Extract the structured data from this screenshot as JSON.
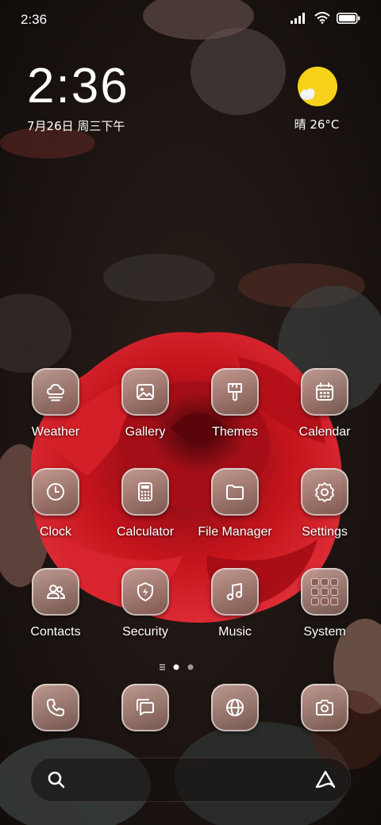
{
  "status_bar": {
    "time": "2:36"
  },
  "clock_widget": {
    "time": "2:36",
    "date": "7月26日 周三下午"
  },
  "weather_widget": {
    "text": "晴 26°C"
  },
  "apps": [
    {
      "label": "Weather",
      "icon": "cloud-icon"
    },
    {
      "label": "Gallery",
      "icon": "image-icon"
    },
    {
      "label": "Themes",
      "icon": "brush-icon"
    },
    {
      "label": "Calendar",
      "icon": "calendar-icon"
    },
    {
      "label": "Clock",
      "icon": "clock-icon"
    },
    {
      "label": "Calculator",
      "icon": "calculator-icon"
    },
    {
      "label": "File Manager",
      "icon": "folder-icon"
    },
    {
      "label": "Settings",
      "icon": "gear-icon"
    },
    {
      "label": "Contacts",
      "icon": "people-icon"
    },
    {
      "label": "Security",
      "icon": "shield-icon"
    },
    {
      "label": "Music",
      "icon": "music-note-icon"
    },
    {
      "label": "System",
      "icon": "folder-grid-icon"
    }
  ],
  "dock": [
    {
      "icon": "phone-icon"
    },
    {
      "icon": "messages-icon"
    },
    {
      "icon": "globe-icon"
    },
    {
      "icon": "camera-icon"
    }
  ],
  "page_indicator": {
    "current": 2,
    "total": 2
  },
  "colors": {
    "tile_top": "#c4a096",
    "tile_bottom": "#785850",
    "sun": "#f7d21b",
    "rose": "#c3141c"
  }
}
